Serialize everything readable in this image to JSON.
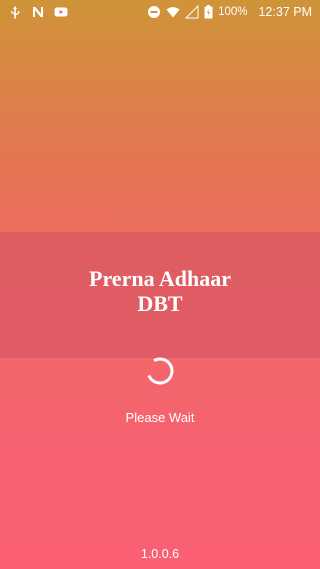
{
  "status_bar": {
    "left_icons": [
      "usb-icon",
      "n-notification-icon",
      "youtube-icon"
    ],
    "right_icons": [
      "do-not-disturb-icon",
      "wifi-icon",
      "no-signal-icon",
      "battery-icon"
    ],
    "battery_percent": "100%",
    "time": "12:37 PM"
  },
  "splash": {
    "title_line1": "Prerna Adhaar",
    "title_line2": "DBT",
    "loading_text": "Please Wait",
    "version": "1.0.0.6"
  },
  "colors": {
    "gradient_top": "#cf9438",
    "gradient_bottom": "#fb5f74",
    "text": "#ffffff"
  }
}
